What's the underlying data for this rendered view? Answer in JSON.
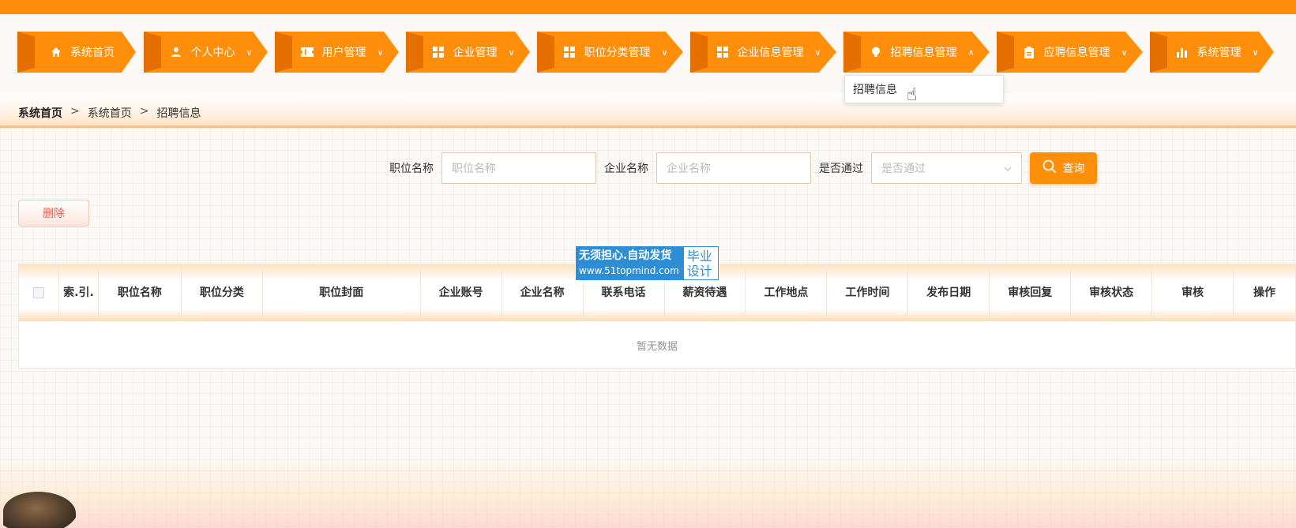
{
  "nav": {
    "items": [
      {
        "label": "系统首页",
        "icon": "home-icon",
        "caret": ""
      },
      {
        "label": "个人中心",
        "icon": "user-icon",
        "caret": "∨"
      },
      {
        "label": "用户管理",
        "icon": "ticket-icon",
        "caret": "∨"
      },
      {
        "label": "企业管理",
        "icon": "grid-icon",
        "caret": "∨"
      },
      {
        "label": "职位分类管理",
        "icon": "grid-icon",
        "caret": "∨"
      },
      {
        "label": "企业信息管理",
        "icon": "grid-icon",
        "caret": "∨"
      },
      {
        "label": "招聘信息管理",
        "icon": "bulb-icon",
        "caret": "∧"
      },
      {
        "label": "应聘信息管理",
        "icon": "clipboard-icon",
        "caret": "∨"
      },
      {
        "label": "系统管理",
        "icon": "bar-chart-icon",
        "caret": "∨"
      }
    ],
    "dropdown_item": "招聘信息"
  },
  "breadcrumb": {
    "home": "系统首页",
    "sep": ">",
    "level2": "系统首页",
    "current": "招聘信息"
  },
  "search": {
    "job_name_label": "职位名称",
    "job_name_placeholder": "职位名称",
    "company_name_label": "企业名称",
    "company_name_placeholder": "企业名称",
    "approved_label": "是否通过",
    "approved_placeholder": "是否通过",
    "query_button": "查询"
  },
  "actions": {
    "delete_button": "删除"
  },
  "table": {
    "columns": [
      "索.引.",
      "职位名称",
      "职位分类",
      "职位封面",
      "企业账号",
      "企业名称",
      "联系电话",
      "薪资待遇",
      "工作地点",
      "工作时间",
      "发布日期",
      "审核回复",
      "审核状态",
      "审核",
      "操作"
    ],
    "empty_text": "暂无数据"
  },
  "watermark": {
    "line1": "无须担心.自动发货",
    "url": "www.51topmind.com",
    "badge_line1": "毕业",
    "badge_line2": "设计"
  },
  "colors": {
    "accent": "#ff8f0a",
    "accent_dark": "#e56f00",
    "delete_text": "#e8604a",
    "watermark_blue": "#2d8ed6"
  }
}
